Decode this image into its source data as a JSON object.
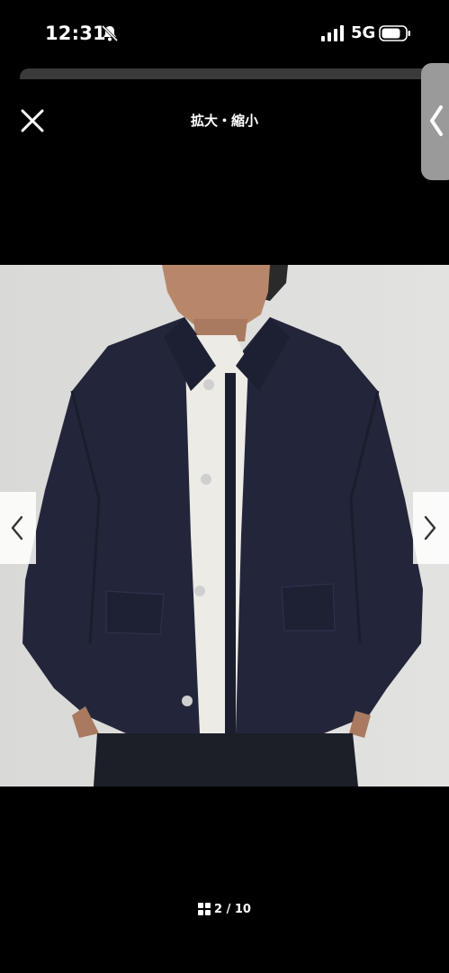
{
  "status_bar": {
    "time": "12:31",
    "network": "5G",
    "bell_icon": "bell-slash-icon",
    "signal_icon": "signal-bars-icon",
    "battery_icon": "battery-icon"
  },
  "header": {
    "title": "拡大・縮小",
    "close_icon": "close-icon"
  },
  "side_handle": {
    "icon": "chevron-left-icon"
  },
  "gallery": {
    "image_alt": "model-wearing-indigo-denim-jacket",
    "prev_icon": "chevron-left-icon",
    "next_icon": "chevron-right-icon",
    "pager_icon": "grid-icon",
    "pager_text": "2 / 10"
  },
  "colors": {
    "background": "#000000",
    "photo_background": "#dcdcdc",
    "denim": "#23263a",
    "nav_button": "#ffffff"
  }
}
